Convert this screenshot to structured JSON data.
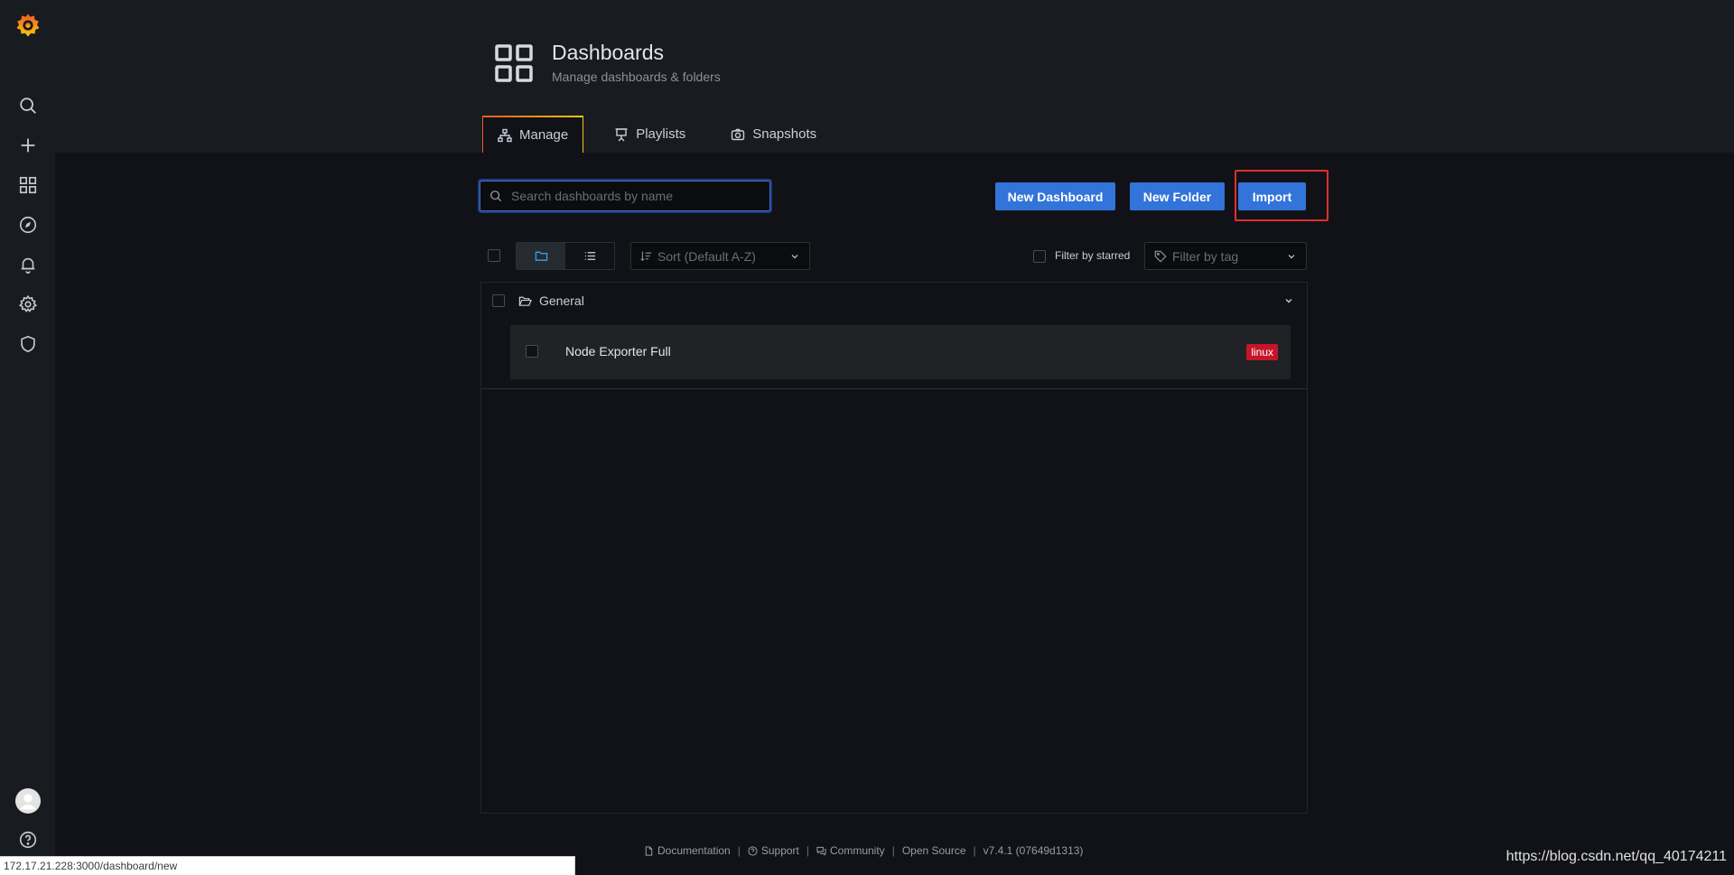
{
  "sidebar": {
    "logo": "grafana-logo-icon",
    "items": [
      {
        "name": "search-icon"
      },
      {
        "name": "plus-icon"
      },
      {
        "name": "dashboards-icon"
      },
      {
        "name": "explore-icon"
      },
      {
        "name": "alerting-bell-icon"
      },
      {
        "name": "configuration-gear-icon"
      },
      {
        "name": "server-admin-shield-icon"
      }
    ],
    "bottom": [
      "profile-avatar",
      "help-icon"
    ]
  },
  "header": {
    "title": "Dashboards",
    "subtitle": "Manage dashboards & folders",
    "tabs": [
      {
        "label": "Manage",
        "icon": "sitemap-icon",
        "active": true
      },
      {
        "label": "Playlists",
        "icon": "presentation-icon",
        "active": false
      },
      {
        "label": "Snapshots",
        "icon": "camera-icon",
        "active": false
      }
    ]
  },
  "toolbar": {
    "search_placeholder": "Search dashboards by name",
    "new_dashboard_label": "New Dashboard",
    "new_folder_label": "New Folder",
    "import_label": "Import",
    "sort_placeholder": "Sort (Default A-Z)",
    "filter_starred_label": "Filter by starred",
    "tag_filter_placeholder": "Filter by tag"
  },
  "results": {
    "folder": {
      "name": "General",
      "expanded": true
    },
    "dashboards": [
      {
        "title": "Node Exporter Full",
        "tags": [
          "linux"
        ]
      }
    ]
  },
  "footer": {
    "links": [
      "Documentation",
      "Support",
      "Community",
      "Open Source"
    ],
    "version": "v7.4.1 (07649d1313)"
  },
  "status_url": "172.17.21.228:3000/dashboard/new",
  "watermark": "https://blog.csdn.net/qq_40174211",
  "colors": {
    "accent_blue": "#3274d9",
    "highlight_red": "#e02f2f",
    "tag_red": "#c4162a",
    "tab_gradient": [
      "#f05a28",
      "#fbca0a"
    ]
  }
}
